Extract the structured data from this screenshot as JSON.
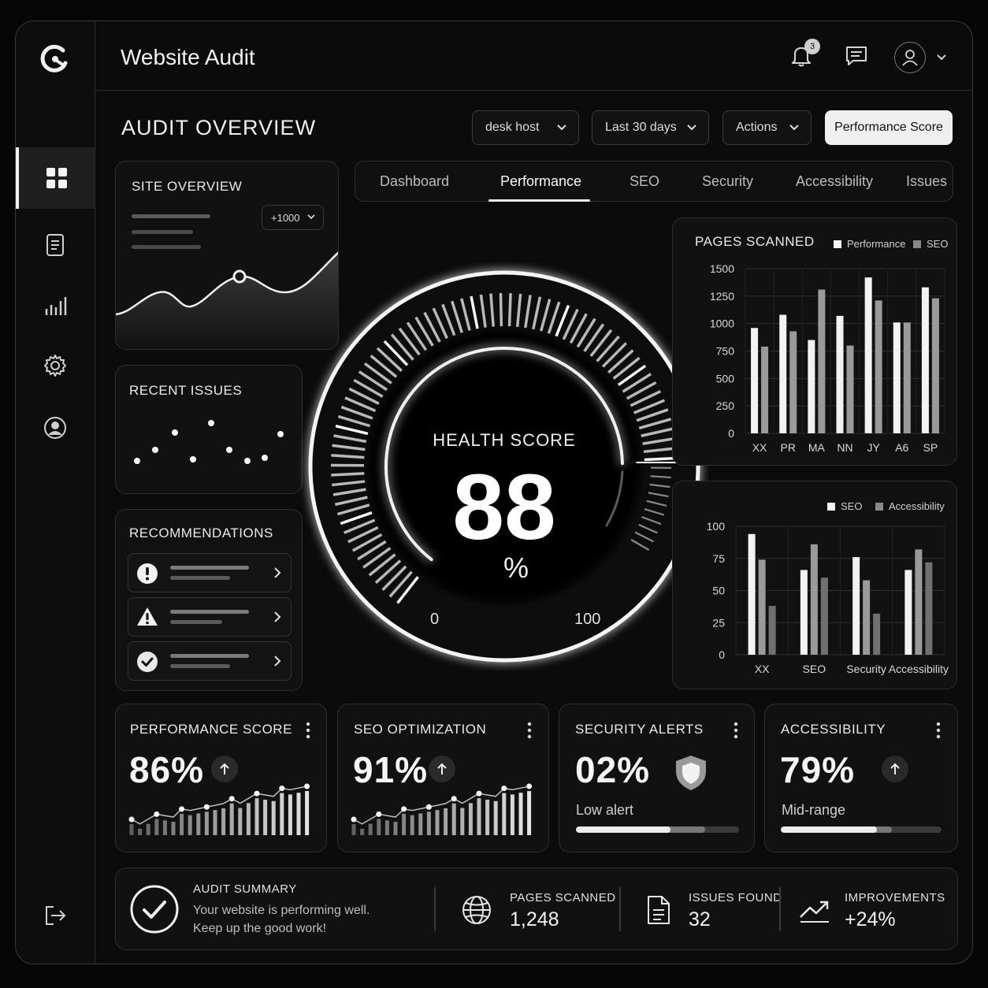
{
  "app": {
    "title": "Website Audit",
    "notification_count": "3"
  },
  "overview": {
    "title": "AUDIT OVERVIEW"
  },
  "filters": {
    "host": "desk host",
    "range": "Last 30 days",
    "actions": "Actions",
    "primary": "Performance Score"
  },
  "tabs": [
    {
      "label": "Dashboard"
    },
    {
      "label": "Performance"
    },
    {
      "label": "SEO"
    },
    {
      "label": "Security"
    },
    {
      "label": "Accessibility"
    },
    {
      "label": "Issues"
    }
  ],
  "site_overview": {
    "title": "SITE OVERVIEW",
    "filter": "+1000"
  },
  "recent_issues": {
    "title": "RECENT ISSUES"
  },
  "recommendations": {
    "title": "RECOMMENDATIONS",
    "icons": [
      "alert-circle-icon",
      "warning-triangle-icon",
      "check-circle-icon"
    ]
  },
  "health": {
    "label": "HEALTH SCORE",
    "value": "88",
    "unit": "%",
    "min": "0",
    "max": "100",
    "score": 88
  },
  "chart_data": [
    {
      "type": "bar",
      "title": "PAGES SCANNED",
      "categories": [
        "XX",
        "PR",
        "MA",
        "NN",
        "JY",
        "A6",
        "SP"
      ],
      "series": [
        {
          "name": "Performance",
          "values": [
            960,
            1080,
            850,
            1070,
            1420,
            1010,
            1330
          ]
        },
        {
          "name": "SEO",
          "values": [
            790,
            930,
            1310,
            800,
            1210,
            1010,
            1230
          ]
        }
      ],
      "yticks": [
        "1500",
        "1250",
        "1000",
        "750",
        "500",
        "250",
        "0"
      ],
      "ylim": [
        0,
        1500
      ]
    },
    {
      "type": "bar",
      "title": "",
      "categories": [
        "XX",
        "SEO",
        "Security",
        "Accessibility"
      ],
      "series": [
        {
          "name": "SEO",
          "values": [
            94,
            66,
            76,
            66
          ]
        },
        {
          "name": "Accessibility",
          "values": [
            74,
            86,
            58,
            82
          ]
        },
        {
          "name": "",
          "values": [
            38,
            60,
            32,
            72
          ]
        }
      ],
      "yticks": [
        "100",
        "75",
        "50",
        "25",
        "0"
      ],
      "ylim": [
        0,
        100
      ]
    }
  ],
  "metrics": [
    {
      "title": "PERFORMANCE SCORE",
      "value": "86%"
    },
    {
      "title": "SEO OPTIMIZATION",
      "value": "91%"
    },
    {
      "title": "SECURITY ALERTS",
      "value": "02%",
      "status": "Low alert",
      "progress": 0.58
    },
    {
      "title": "ACCESSIBILITY",
      "value": "79%",
      "status": "Mid-range",
      "progress": 0.6
    }
  ],
  "summary": {
    "title": "AUDIT SUMMARY",
    "line1": "Your website is performing well.",
    "line2": "Keep up the good work!",
    "stats": [
      {
        "label": "PAGES SCANNED",
        "value": "1,248"
      },
      {
        "label": "ISSUES FOUND",
        "value": "32"
      },
      {
        "label": "IMPROVEMENTS",
        "value": "+24%"
      }
    ]
  }
}
